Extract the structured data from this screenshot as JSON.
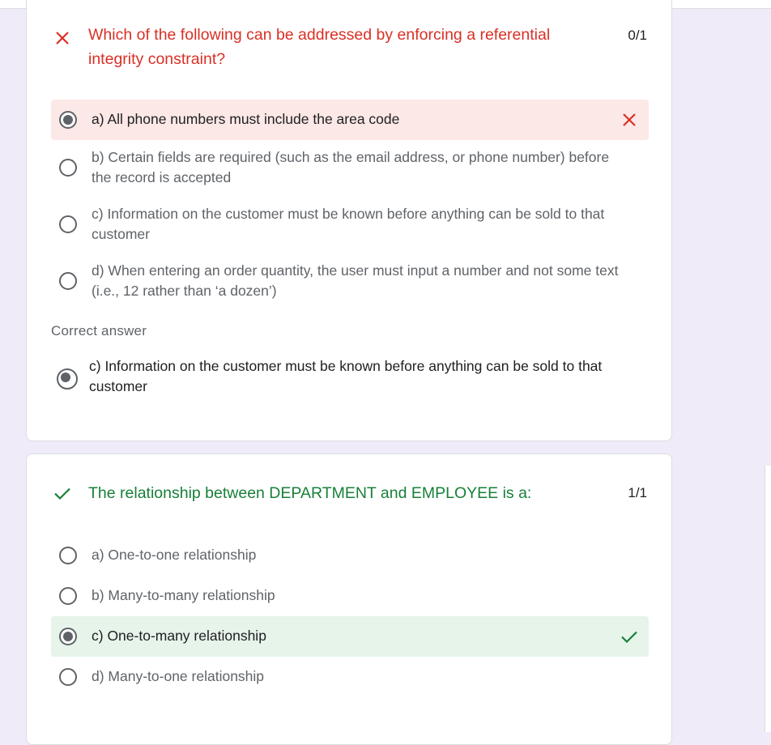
{
  "questions": [
    {
      "status": "incorrect",
      "status_icon": "x-icon",
      "text": "Which of the following can be addressed by enforcing a referential integrity constraint?",
      "points": "0/1",
      "options": [
        {
          "label": "a) All phone numbers must include the area code",
          "selected": true,
          "result": "wrong"
        },
        {
          "label": "b) Certain fields are required (such as the email address, or phone number) before the record is accepted",
          "selected": false
        },
        {
          "label": "c) Information on the customer must be known before anything can be sold to that customer",
          "selected": false
        },
        {
          "label": "d) When entering an order quantity, the user must input a number and not some text (i.e., 12 rather than ‘a dozen’)",
          "selected": false
        }
      ],
      "correct_answer_title": "Correct answer",
      "correct_answer": "c) Information on the customer must be known before anything can be sold to that customer"
    },
    {
      "status": "correct",
      "status_icon": "check-icon",
      "text": "The relationship between DEPARTMENT and EMPLOYEE is a:",
      "points": "1/1",
      "options": [
        {
          "label": "a) One-to-one relationship",
          "selected": false
        },
        {
          "label": "b) Many-to-many relationship",
          "selected": false
        },
        {
          "label": "c) One-to-many relationship",
          "selected": true,
          "result": "right"
        },
        {
          "label": "d) Many-to-one relationship",
          "selected": false
        }
      ]
    }
  ],
  "colors": {
    "incorrect": "#d93025",
    "correct": "#188038",
    "background": "#f0ebf8"
  }
}
